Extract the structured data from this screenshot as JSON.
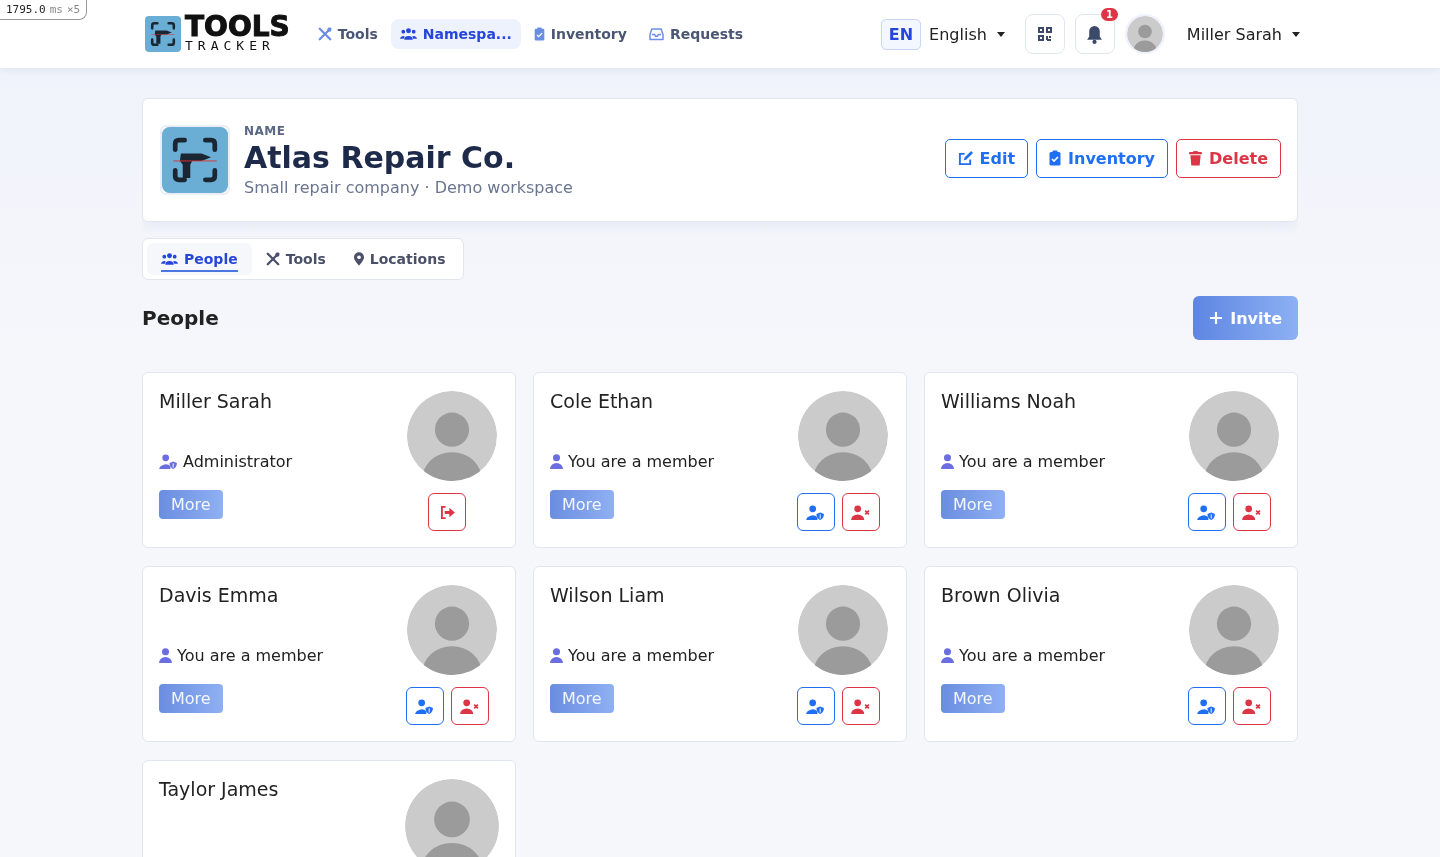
{
  "debug_badge": {
    "time": "1795.0",
    "unit": "ms",
    "count": "×5"
  },
  "navbar": {
    "logo": {
      "line_1": "TOOLS",
      "line_2": "TRACKER"
    },
    "links": [
      {
        "label": "Tools",
        "kind": "tools",
        "selected": false
      },
      {
        "label": "Namespa...",
        "kind": "people",
        "selected": true
      },
      {
        "label": "Inventory",
        "kind": "clipboard",
        "selected": false
      },
      {
        "label": "Requests",
        "kind": "inbox",
        "selected": false
      }
    ],
    "language": {
      "code": "EN",
      "label": "English"
    },
    "notifications": {
      "count": "1"
    },
    "user": {
      "name": "Miller Sarah"
    }
  },
  "organization": {
    "label": "NAME",
    "name": "Atlas Repair Co.",
    "description": "Small repair company · Demo workspace",
    "actions": [
      {
        "label": "Edit",
        "kind": "edit"
      },
      {
        "label": "Inventory",
        "kind": "inventory"
      },
      {
        "label": "Delete",
        "kind": "delete"
      }
    ]
  },
  "tabs": [
    {
      "label": "People",
      "kind": "people",
      "selected": true
    },
    {
      "label": "Tools",
      "kind": "tools",
      "selected": false
    },
    {
      "label": "Locations",
      "kind": "pin",
      "selected": false
    }
  ],
  "section": {
    "title": "People",
    "invite_label": "Invite"
  },
  "members": [
    {
      "name": "Miller Sarah",
      "kind": "admin",
      "role": "Administrator",
      "more": "More"
    },
    {
      "name": "Cole Ethan",
      "kind": "member",
      "role": "You are a member",
      "more": "More"
    },
    {
      "name": "Williams Noah",
      "kind": "member",
      "role": "You are a member",
      "more": "More"
    },
    {
      "name": "Davis Emma",
      "kind": "member",
      "role": "You are a member",
      "more": "More"
    },
    {
      "name": "Wilson Liam",
      "kind": "member",
      "role": "You are a member",
      "more": "More"
    },
    {
      "name": "Brown Olivia",
      "kind": "member",
      "role": "You are a member",
      "more": "More"
    },
    {
      "name": "Taylor James",
      "kind": "cut"
    }
  ]
}
